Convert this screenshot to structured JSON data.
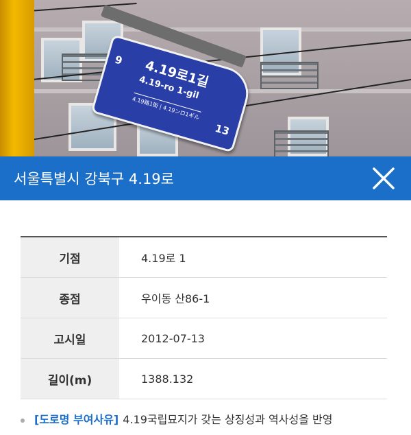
{
  "photo": {
    "sign": {
      "main_text": "4.19로1길",
      "roman_text": "4.19-ro 1-gil",
      "sub_text": "4.19路1街 | 4.19ンロ1ギル",
      "start_number": "9",
      "end_number": "13"
    }
  },
  "header": {
    "title": "서울특별시 강북구 4.19로",
    "close_icon": "close-icon"
  },
  "table": {
    "rows": [
      {
        "key": "기점",
        "value": "4.19로 1"
      },
      {
        "key": "종점",
        "value": "우이동 산86-1"
      },
      {
        "key": "고시일",
        "value": "2012-07-13"
      },
      {
        "key": "길이(m)",
        "value": "1388.132"
      }
    ]
  },
  "note": {
    "label": "[도로명 부여사유]",
    "text": "4.19국립묘지가 갖는 상징성과 역사성을 반영"
  },
  "colors": {
    "header_blue": "#1b6fc8",
    "sign_blue": "#2a3ea8",
    "label_blue": "#1b6fc8"
  }
}
